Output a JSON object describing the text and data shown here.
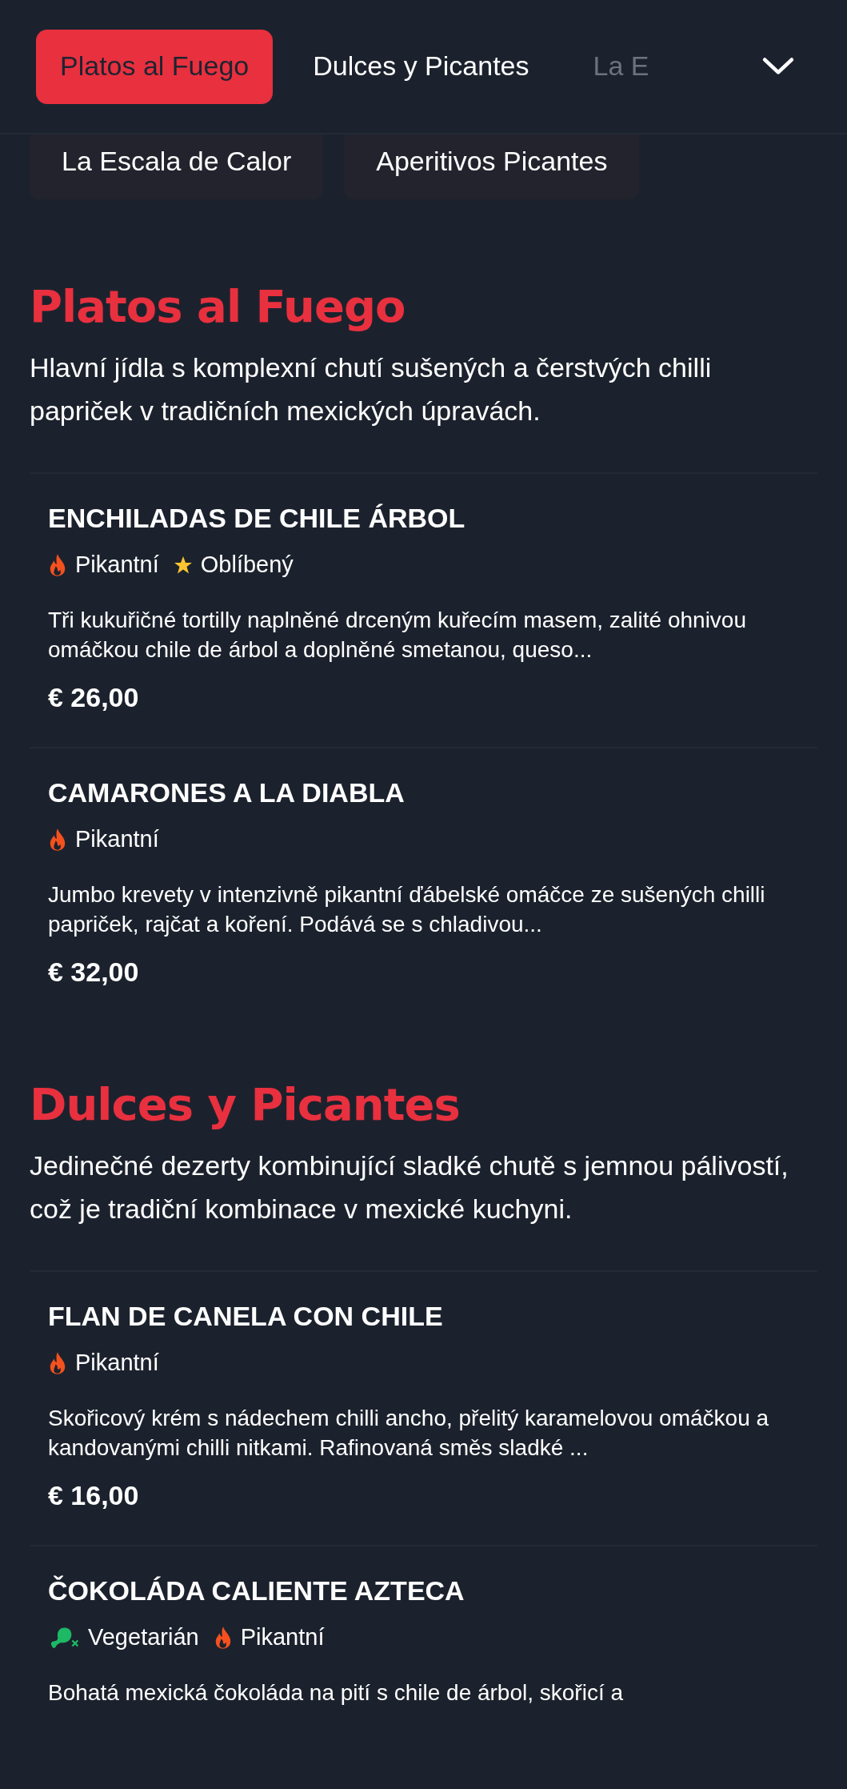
{
  "tabs": [
    {
      "label": "Platos al Fuego",
      "selected": true
    },
    {
      "label": "Dulces y Picantes",
      "selected": false
    },
    {
      "label": "La E",
      "selected": false
    }
  ],
  "more_categories": [
    "La Escala de Calor",
    "Aperitivos Picantes"
  ],
  "sections": [
    {
      "title": "Platos al Fuego",
      "description": "Hlavní jídla s komplexní chutí sušených a čerstvých chilli papriček v tradičních mexických úpravách.",
      "items": [
        {
          "name": "ENCHILADAS DE CHILE ÁRBOL",
          "tags": [
            {
              "kind": "spicy",
              "label": "Pikantní"
            },
            {
              "kind": "favorite",
              "label": "Oblíbený"
            }
          ],
          "description": "Tři kukuřičné tortilly naplněné drceným kuřecím masem, zalité ohnivou omáčkou chile de árbol a doplněné smetanou, queso...",
          "price": "€ 26,00"
        },
        {
          "name": "CAMARONES A LA DIABLA",
          "tags": [
            {
              "kind": "spicy",
              "label": "Pikantní"
            }
          ],
          "description": "Jumbo krevety v intenzivně pikantní ďábelské omáčce ze sušených chilli papriček, rajčat a koření. Podává se s chladivou...",
          "price": "€ 32,00"
        }
      ]
    },
    {
      "title": "Dulces y Picantes",
      "description": "Jedinečné dezerty kombinující sladké chutě s jemnou pálivostí, což je tradiční kombinace v mexické kuchyni.",
      "items": [
        {
          "name": "FLAN DE CANELA CON CHILE",
          "tags": [
            {
              "kind": "spicy",
              "label": "Pikantní"
            }
          ],
          "description": "Skořicový krém s nádechem chilli ancho, přelitý karamelovou omáčkou a kandovanými chilli nitkami. Rafinovaná směs sladké ...",
          "price": "€ 16,00"
        },
        {
          "name": "ČOKOLÁDA CALIENTE AZTECA",
          "tags": [
            {
              "kind": "vegetarian",
              "label": "Vegetarián"
            },
            {
              "kind": "spicy",
              "label": "Pikantní"
            }
          ],
          "description": "Bohatá mexická čokoláda na pití s chile de árbol, skořicí a"
        }
      ]
    }
  ]
}
